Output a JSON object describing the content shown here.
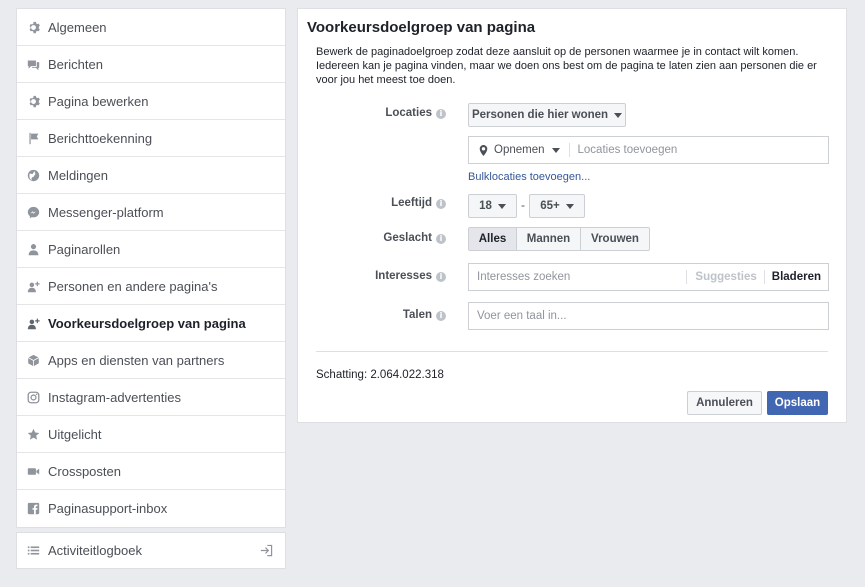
{
  "sidebar": {
    "items": [
      {
        "label": "Algemeen",
        "icon": "gear-icon"
      },
      {
        "label": "Berichten",
        "icon": "message-icon"
      },
      {
        "label": "Pagina bewerken",
        "icon": "gear-icon"
      },
      {
        "label": "Berichttoekenning",
        "icon": "flag-icon"
      },
      {
        "label": "Meldingen",
        "icon": "globe-icon"
      },
      {
        "label": "Messenger-platform",
        "icon": "messenger-icon"
      },
      {
        "label": "Paginarollen",
        "icon": "person-icon"
      },
      {
        "label": "Personen en andere pagina's",
        "icon": "people-icon"
      },
      {
        "label": "Voorkeursdoelgroep van pagina",
        "icon": "people-icon",
        "active": true
      },
      {
        "label": "Apps en diensten van partners",
        "icon": "cube-icon"
      },
      {
        "label": "Instagram-advertenties",
        "icon": "instagram-icon"
      },
      {
        "label": "Uitgelicht",
        "icon": "star-icon"
      },
      {
        "label": "Crossposten",
        "icon": "video-icon"
      },
      {
        "label": "Paginasupport-inbox",
        "icon": "facebook-icon"
      }
    ],
    "activity_log": {
      "label": "Activiteitlogboek",
      "icon": "list-icon",
      "exit_icon": "exit-icon"
    }
  },
  "main": {
    "title": "Voorkeursdoelgroep van pagina",
    "description": "Bewerk de paginadoelgroep zodat deze aansluit op de personen waarmee je in contact wilt komen. Iedereen kan je pagina vinden, maar we doen ons best om de pagina te laten zien aan personen die er voor jou het meest toe doen.",
    "locations": {
      "label": "Locaties",
      "dropdown": "Personen die hier wonen",
      "include": "Opnemen",
      "placeholder": "Locaties toevoegen",
      "bulk_link": "Bulklocaties toevoegen..."
    },
    "age": {
      "label": "Leeftijd",
      "min": "18",
      "max": "65+",
      "separator": "-"
    },
    "gender": {
      "label": "Geslacht",
      "options": [
        "Alles",
        "Mannen",
        "Vrouwen"
      ],
      "selected": "Alles"
    },
    "interests": {
      "label": "Interesses",
      "placeholder": "Interesses zoeken",
      "suggestions": "Suggesties",
      "browse": "Bladeren"
    },
    "languages": {
      "label": "Talen",
      "placeholder": "Voer een taal in..."
    },
    "estimate": "Schatting: 2.064.022.318",
    "cancel": "Annuleren",
    "save": "Opslaan"
  }
}
